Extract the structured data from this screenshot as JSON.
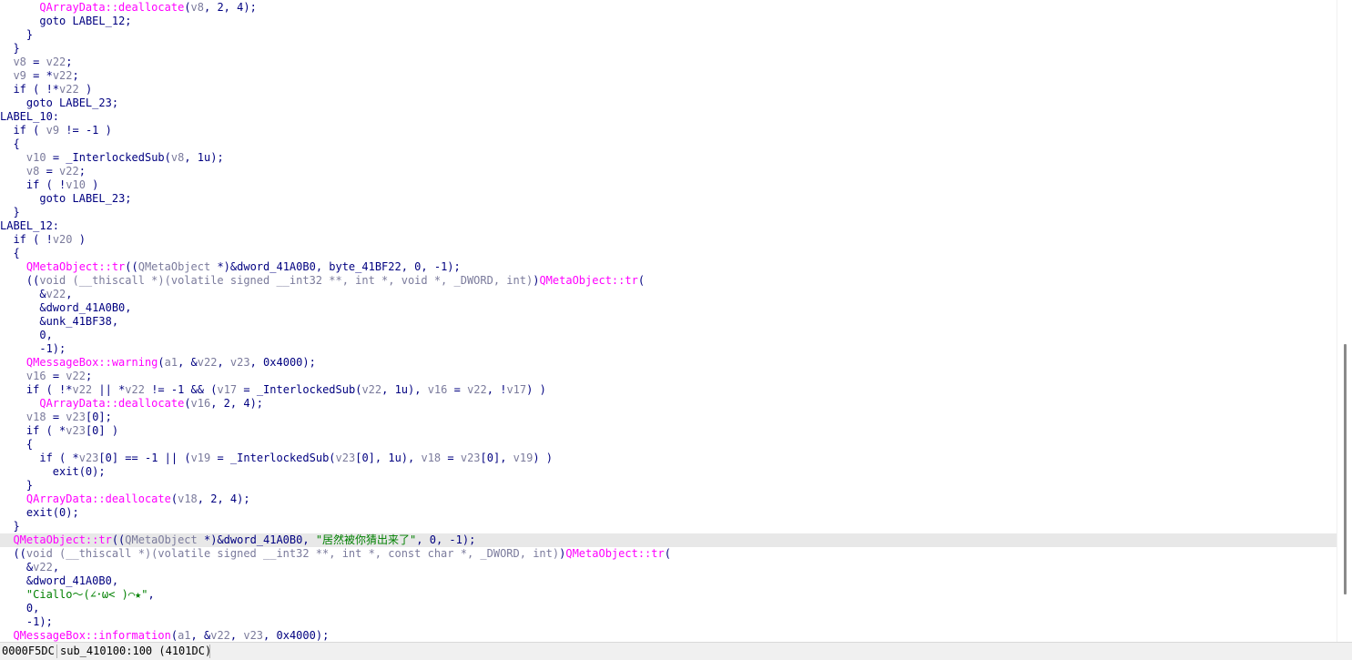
{
  "editor": {
    "lines": [
      {
        "indent": 6,
        "tokens": [
          [
            "func",
            "QArrayData::deallocate"
          ],
          [
            "text",
            "("
          ],
          [
            "var",
            "v8"
          ],
          [
            "text",
            ", 2, 4);"
          ]
        ]
      },
      {
        "indent": 6,
        "tokens": [
          [
            "kw",
            "goto"
          ],
          [
            "text",
            " LABEL_12;"
          ]
        ]
      },
      {
        "indent": 4,
        "tokens": [
          [
            "text",
            "}"
          ]
        ]
      },
      {
        "indent": 2,
        "tokens": [
          [
            "text",
            "}"
          ]
        ]
      },
      {
        "indent": 2,
        "tokens": [
          [
            "var",
            "v8"
          ],
          [
            "text",
            " = "
          ],
          [
            "var",
            "v22"
          ],
          [
            "text",
            ";"
          ]
        ]
      },
      {
        "indent": 2,
        "tokens": [
          [
            "var",
            "v9"
          ],
          [
            "text",
            " = *"
          ],
          [
            "var",
            "v22"
          ],
          [
            "text",
            ";"
          ]
        ]
      },
      {
        "indent": 2,
        "tokens": [
          [
            "kw",
            "if"
          ],
          [
            "text",
            " ( !*"
          ],
          [
            "var",
            "v22"
          ],
          [
            "text",
            " )"
          ]
        ]
      },
      {
        "indent": 4,
        "tokens": [
          [
            "kw",
            "goto"
          ],
          [
            "text",
            " LABEL_23;"
          ]
        ]
      },
      {
        "indent": 0,
        "tokens": [
          [
            "label",
            "LABEL_10:"
          ]
        ]
      },
      {
        "indent": 2,
        "tokens": [
          [
            "kw",
            "if"
          ],
          [
            "text",
            " ( "
          ],
          [
            "var",
            "v9"
          ],
          [
            "text",
            " != -1 )"
          ]
        ]
      },
      {
        "indent": 2,
        "tokens": [
          [
            "text",
            "{"
          ]
        ]
      },
      {
        "indent": 4,
        "tokens": [
          [
            "var",
            "v10"
          ],
          [
            "text",
            " = _InterlockedSub("
          ],
          [
            "var",
            "v8"
          ],
          [
            "text",
            ", 1u);"
          ]
        ]
      },
      {
        "indent": 4,
        "tokens": [
          [
            "var",
            "v8"
          ],
          [
            "text",
            " = "
          ],
          [
            "var",
            "v22"
          ],
          [
            "text",
            ";"
          ]
        ]
      },
      {
        "indent": 4,
        "tokens": [
          [
            "kw",
            "if"
          ],
          [
            "text",
            " ( !"
          ],
          [
            "var",
            "v10"
          ],
          [
            "text",
            " )"
          ]
        ]
      },
      {
        "indent": 6,
        "tokens": [
          [
            "kw",
            "goto"
          ],
          [
            "text",
            " LABEL_23;"
          ]
        ]
      },
      {
        "indent": 2,
        "tokens": [
          [
            "text",
            "}"
          ]
        ]
      },
      {
        "indent": 0,
        "tokens": [
          [
            "label",
            "LABEL_12:"
          ]
        ]
      },
      {
        "indent": 2,
        "tokens": [
          [
            "kw",
            "if"
          ],
          [
            "text",
            " ( !"
          ],
          [
            "var",
            "v20"
          ],
          [
            "text",
            " )"
          ]
        ]
      },
      {
        "indent": 2,
        "tokens": [
          [
            "text",
            "{"
          ]
        ]
      },
      {
        "indent": 4,
        "tokens": [
          [
            "func",
            "QMetaObject::tr"
          ],
          [
            "text",
            "(("
          ],
          [
            "cls",
            "QMetaObject"
          ],
          [
            "text",
            " *)&dword_41A0B0, byte_41BF22, 0, -1);"
          ]
        ]
      },
      {
        "indent": 4,
        "tokens": [
          [
            "text",
            "(("
          ],
          [
            "cls",
            "void (__thiscall *)(volatile signed __int32 **, int *, void *, _DWORD, int)"
          ],
          [
            "text",
            ")"
          ],
          [
            "func",
            "QMetaObject::tr"
          ],
          [
            "text",
            "("
          ]
        ]
      },
      {
        "indent": 6,
        "tokens": [
          [
            "text",
            "&"
          ],
          [
            "var",
            "v22"
          ],
          [
            "text",
            ","
          ]
        ]
      },
      {
        "indent": 6,
        "tokens": [
          [
            "text",
            "&dword_41A0B0,"
          ]
        ]
      },
      {
        "indent": 6,
        "tokens": [
          [
            "text",
            "&unk_41BF38,"
          ]
        ]
      },
      {
        "indent": 6,
        "tokens": [
          [
            "text",
            "0,"
          ]
        ]
      },
      {
        "indent": 6,
        "tokens": [
          [
            "text",
            "-1);"
          ]
        ]
      },
      {
        "indent": 4,
        "tokens": [
          [
            "func",
            "QMessageBox::warning"
          ],
          [
            "text",
            "("
          ],
          [
            "var",
            "a1"
          ],
          [
            "text",
            ", &"
          ],
          [
            "var",
            "v22"
          ],
          [
            "text",
            ", "
          ],
          [
            "var",
            "v23"
          ],
          [
            "text",
            ", 0x4000);"
          ]
        ]
      },
      {
        "indent": 4,
        "tokens": [
          [
            "var",
            "v16"
          ],
          [
            "text",
            " = "
          ],
          [
            "var",
            "v22"
          ],
          [
            "text",
            ";"
          ]
        ]
      },
      {
        "indent": 4,
        "tokens": [
          [
            "kw",
            "if"
          ],
          [
            "text",
            " ( !*"
          ],
          [
            "var",
            "v22"
          ],
          [
            "text",
            " || *"
          ],
          [
            "var",
            "v22"
          ],
          [
            "text",
            " != -1 && ("
          ],
          [
            "var",
            "v17"
          ],
          [
            "text",
            " = _InterlockedSub("
          ],
          [
            "var",
            "v22"
          ],
          [
            "text",
            ", 1u), "
          ],
          [
            "var",
            "v16"
          ],
          [
            "text",
            " = "
          ],
          [
            "var",
            "v22"
          ],
          [
            "text",
            ", !"
          ],
          [
            "var",
            "v17"
          ],
          [
            "text",
            ") )"
          ]
        ]
      },
      {
        "indent": 6,
        "tokens": [
          [
            "func",
            "QArrayData::deallocate"
          ],
          [
            "text",
            "("
          ],
          [
            "var",
            "v16"
          ],
          [
            "text",
            ", 2, 4);"
          ]
        ]
      },
      {
        "indent": 4,
        "tokens": [
          [
            "var",
            "v18"
          ],
          [
            "text",
            " = "
          ],
          [
            "var",
            "v23"
          ],
          [
            "text",
            "[0];"
          ]
        ]
      },
      {
        "indent": 4,
        "tokens": [
          [
            "kw",
            "if"
          ],
          [
            "text",
            " ( *"
          ],
          [
            "var",
            "v23"
          ],
          [
            "text",
            "[0] )"
          ]
        ]
      },
      {
        "indent": 4,
        "tokens": [
          [
            "text",
            "{"
          ]
        ]
      },
      {
        "indent": 6,
        "tokens": [
          [
            "kw",
            "if"
          ],
          [
            "text",
            " ( *"
          ],
          [
            "var",
            "v23"
          ],
          [
            "text",
            "[0] == -1 || ("
          ],
          [
            "var",
            "v19"
          ],
          [
            "text",
            " = _InterlockedSub("
          ],
          [
            "var",
            "v23"
          ],
          [
            "text",
            "[0], 1u), "
          ],
          [
            "var",
            "v18"
          ],
          [
            "text",
            " = "
          ],
          [
            "var",
            "v23"
          ],
          [
            "text",
            "[0], "
          ],
          [
            "var",
            "v19"
          ],
          [
            "text",
            ") )"
          ]
        ]
      },
      {
        "indent": 8,
        "tokens": [
          [
            "text",
            "exit(0);"
          ]
        ]
      },
      {
        "indent": 4,
        "tokens": [
          [
            "text",
            "}"
          ]
        ]
      },
      {
        "indent": 4,
        "tokens": [
          [
            "func",
            "QArrayData::deallocate"
          ],
          [
            "text",
            "("
          ],
          [
            "var",
            "v18"
          ],
          [
            "text",
            ", 2, 4);"
          ]
        ]
      },
      {
        "indent": 4,
        "tokens": [
          [
            "text",
            "exit(0);"
          ]
        ]
      },
      {
        "indent": 2,
        "tokens": [
          [
            "text",
            "}"
          ]
        ]
      },
      {
        "indent": 2,
        "current": true,
        "tokens": [
          [
            "func",
            "QMetaObject::tr"
          ],
          [
            "text",
            "(("
          ],
          [
            "cls",
            "QMetaObject"
          ],
          [
            "text",
            " *)&dword_41A0B0, "
          ],
          [
            "str",
            "\"居然被你猜出来了\""
          ],
          [
            "text",
            ", 0, -1);"
          ]
        ]
      },
      {
        "indent": 2,
        "tokens": [
          [
            "text",
            "(("
          ],
          [
            "cls",
            "void (__thiscall *)(volatile signed __int32 **, int *, const char *, _DWORD, int)"
          ],
          [
            "text",
            ")"
          ],
          [
            "func",
            "QMetaObject::tr"
          ],
          [
            "text",
            "("
          ]
        ]
      },
      {
        "indent": 4,
        "tokens": [
          [
            "text",
            "&"
          ],
          [
            "var",
            "v22"
          ],
          [
            "text",
            ","
          ]
        ]
      },
      {
        "indent": 4,
        "tokens": [
          [
            "text",
            "&dword_41A0B0,"
          ]
        ]
      },
      {
        "indent": 4,
        "tokens": [
          [
            "str",
            "\"Ciallo～(∠･ω< )⌒★\""
          ],
          [
            "text",
            ","
          ]
        ]
      },
      {
        "indent": 4,
        "tokens": [
          [
            "text",
            "0,"
          ]
        ]
      },
      {
        "indent": 4,
        "tokens": [
          [
            "text",
            "-1);"
          ]
        ]
      },
      {
        "indent": 2,
        "tokens": [
          [
            "func",
            "QMessageBox::information"
          ],
          [
            "text",
            "("
          ],
          [
            "var",
            "a1"
          ],
          [
            "text",
            ", &"
          ],
          [
            "var",
            "v22"
          ],
          [
            "text",
            ", "
          ],
          [
            "var",
            "v23"
          ],
          [
            "text",
            ", 0x4000);"
          ]
        ]
      }
    ]
  },
  "statusbar": {
    "address": "0000F5DC",
    "location": "sub_410100:100 (4101DC)"
  },
  "colors": {
    "background": "#ffffff",
    "text": "#000080",
    "variable": "#7b7b9c",
    "function": "#ff00ff",
    "string": "#008000",
    "current_line": "#e8e8e8"
  }
}
